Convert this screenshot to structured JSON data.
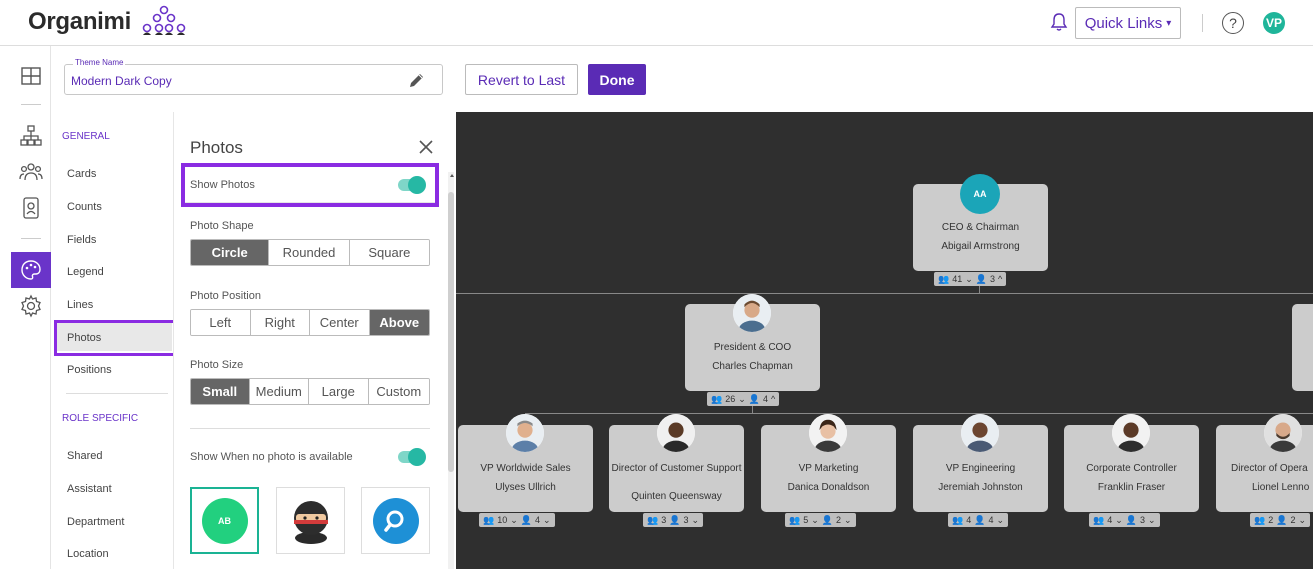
{
  "header": {
    "brand": "Organimi",
    "quick_links": "Quick Links",
    "help": "?",
    "user_initials": "VP"
  },
  "theme": {
    "name_label": "Theme Name",
    "name_value": "Modern Dark Copy",
    "revert_label": "Revert to Last",
    "done_label": "Done"
  },
  "settings_nav": {
    "general_header": "GENERAL",
    "general_items": [
      "Cards",
      "Counts",
      "Fields",
      "Legend",
      "Lines",
      "Photos",
      "Positions"
    ],
    "active_item": "Photos",
    "role_header": "ROLE SPECIFIC",
    "role_items": [
      "Shared",
      "Assistant",
      "Department",
      "Location"
    ]
  },
  "photos_panel": {
    "title": "Photos",
    "show_photos_label": "Show Photos",
    "show_photos_on": true,
    "shape_label": "Photo Shape",
    "shape_options": [
      "Circle",
      "Rounded",
      "Square"
    ],
    "shape_selected": "Circle",
    "position_label": "Photo Position",
    "position_options": [
      "Left",
      "Right",
      "Center",
      "Above"
    ],
    "position_selected": "Above",
    "size_label": "Photo Size",
    "size_options": [
      "Small",
      "Medium",
      "Large",
      "Custom"
    ],
    "size_selected": "Small",
    "no_photo_label": "Show When no photo is available",
    "no_photo_on": true,
    "fallback_initials": "AB"
  },
  "chart": {
    "background": "#2f2f2f",
    "ceo": {
      "initials": "AA",
      "title": "CEO & Chairman",
      "name": "Abigail Armstrong",
      "people": "41",
      "direct": "3"
    },
    "president": {
      "title": "President & COO",
      "name": "Charles Chapman",
      "people": "26",
      "direct": "4"
    },
    "reports": [
      {
        "title": "VP Worldwide Sales",
        "name": "Ulyses Ullrich",
        "people": "10",
        "direct": "4"
      },
      {
        "title": "Director of Customer Support",
        "name": "Quinten Queensway",
        "people": "3",
        "direct": "3"
      },
      {
        "title": "VP Marketing",
        "name": "Danica Donaldson",
        "people": "5",
        "direct": "2"
      },
      {
        "title": "VP Engineering",
        "name": "Jeremiah Johnston",
        "people": "4",
        "direct": "4"
      },
      {
        "title": "Corporate Controller",
        "name": "Franklin Fraser",
        "people": "4",
        "direct": "3"
      },
      {
        "title": "Director of Opera",
        "name": "Lionel Lenno",
        "people": "2",
        "direct": "2"
      }
    ]
  },
  "colors": {
    "brand_purple": "#5a2bb5",
    "highlight_purple": "#8a2be2",
    "toggle_teal": "#26b8a4"
  }
}
